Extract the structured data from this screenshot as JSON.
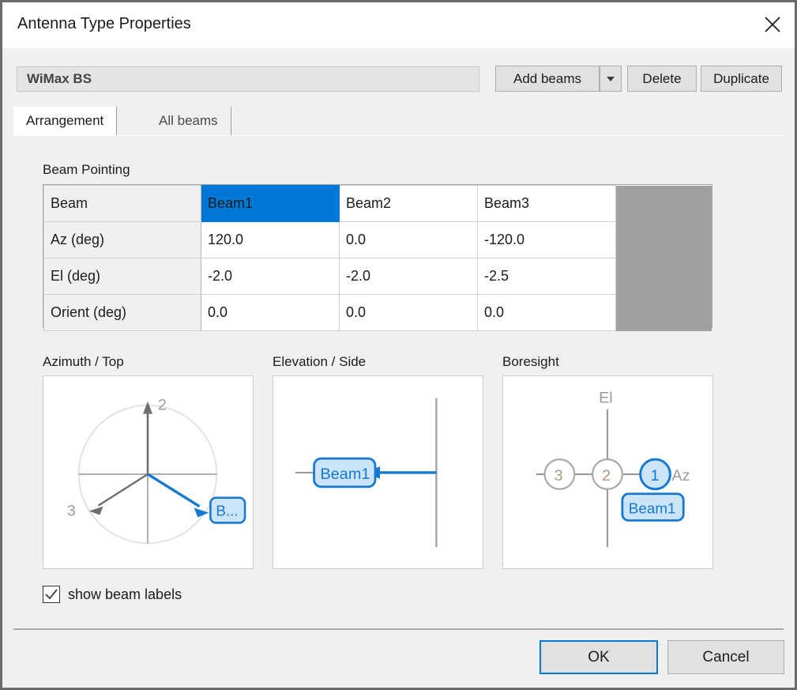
{
  "window": {
    "title": "Antenna Type Properties",
    "close_icon": "close-icon"
  },
  "toolbar": {
    "name_value": "WiMax BS",
    "add_beams_label": "Add beams",
    "add_beams_caret_icon": "chevron-down-icon",
    "delete_label": "Delete",
    "duplicate_label": "Duplicate"
  },
  "tabs": [
    {
      "label": "Arrangement",
      "active": true
    },
    {
      "label": "All beams",
      "active": false
    }
  ],
  "beam_pointing": {
    "group_label": "Beam Pointing",
    "rows": [
      {
        "header": "Beam",
        "values": [
          "Beam1",
          "Beam2",
          "Beam3"
        ]
      },
      {
        "header": "Az (deg)",
        "values": [
          "120.0",
          "0.0",
          "-120.0"
        ]
      },
      {
        "header": "El (deg)",
        "values": [
          "-2.0",
          "-2.0",
          "-2.5"
        ]
      },
      {
        "header": "Orient (deg)",
        "values": [
          "0.0",
          "0.0",
          "0.0"
        ]
      }
    ],
    "selected_cell": {
      "row": 0,
      "col": 0
    }
  },
  "diagrams": {
    "azimuth": {
      "title": "Azimuth / Top",
      "beam_labels": [
        "B...",
        "2",
        "3"
      ],
      "selected_label": "B..."
    },
    "elevation": {
      "title": "Elevation / Side",
      "selected_label": "Beam1"
    },
    "boresight": {
      "title": "Boresight",
      "axis_el": "El",
      "axis_az": "Az",
      "nodes": [
        "3",
        "2",
        "1"
      ],
      "selected_node": "1",
      "selected_label": "Beam1"
    }
  },
  "options": {
    "show_beam_labels": {
      "label": "show beam labels",
      "checked": true,
      "check_icon": "check-icon"
    }
  },
  "footer": {
    "ok_label": "OK",
    "cancel_label": "Cancel"
  },
  "colors": {
    "accent_blue": "#0078d7",
    "label_fill": "#cce4f7",
    "gray_line": "#888888",
    "filler_gray": "#a0a0a0"
  }
}
